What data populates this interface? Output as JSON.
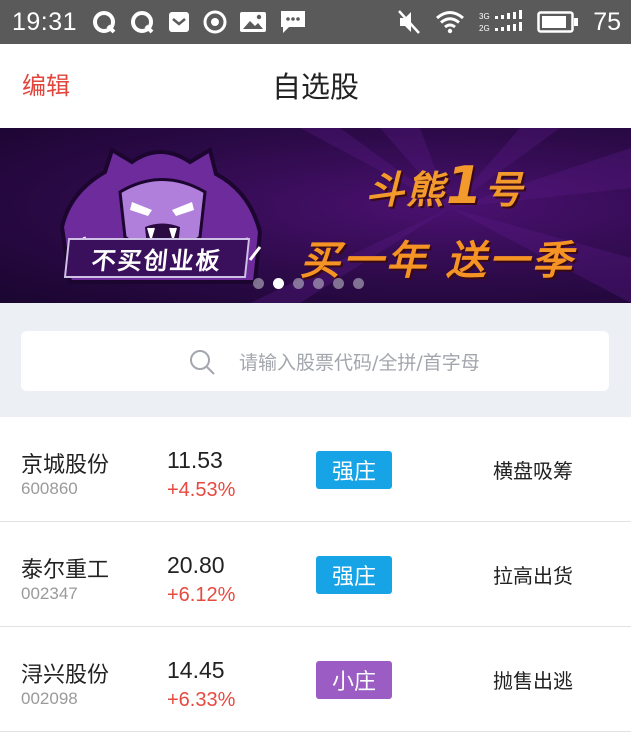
{
  "status_bar": {
    "time": "19:31",
    "battery": "75",
    "icons": [
      "q-app-icon",
      "q-app-icon",
      "mail-icon",
      "target-icon",
      "image-icon",
      "message-icon",
      "mute-icon",
      "wifi-icon",
      "signal-icon",
      "battery-icon"
    ]
  },
  "nav": {
    "edit_label": "编辑",
    "title": "自选股"
  },
  "banner": {
    "tag": "不买创业板",
    "title_prefix": "斗熊",
    "title_number": "1",
    "title_suffix": "号",
    "slogan": "买一年 送一季",
    "slide_count": 6,
    "active_slide": 1
  },
  "search": {
    "placeholder": "请输入股票代码/全拼/首字母"
  },
  "stocks": [
    {
      "name": "京城股份",
      "code": "600860",
      "price": "11.53",
      "change": "+4.53%",
      "badge": "强庄",
      "badge_color": "#17a4e6",
      "signal": "横盘吸筹"
    },
    {
      "name": "泰尔重工",
      "code": "002347",
      "price": "20.80",
      "change": "+6.12%",
      "badge": "强庄",
      "badge_color": "#17a4e6",
      "signal": "拉高出货"
    },
    {
      "name": "浔兴股份",
      "code": "002098",
      "price": "14.45",
      "change": "+6.33%",
      "badge": "小庄",
      "badge_color": "#9b5cc4",
      "signal": "抛售出逃"
    }
  ],
  "colors": {
    "accent_red": "#e2453c",
    "up_red": "#e64a3f",
    "banner_orange": "#f39a2d"
  }
}
